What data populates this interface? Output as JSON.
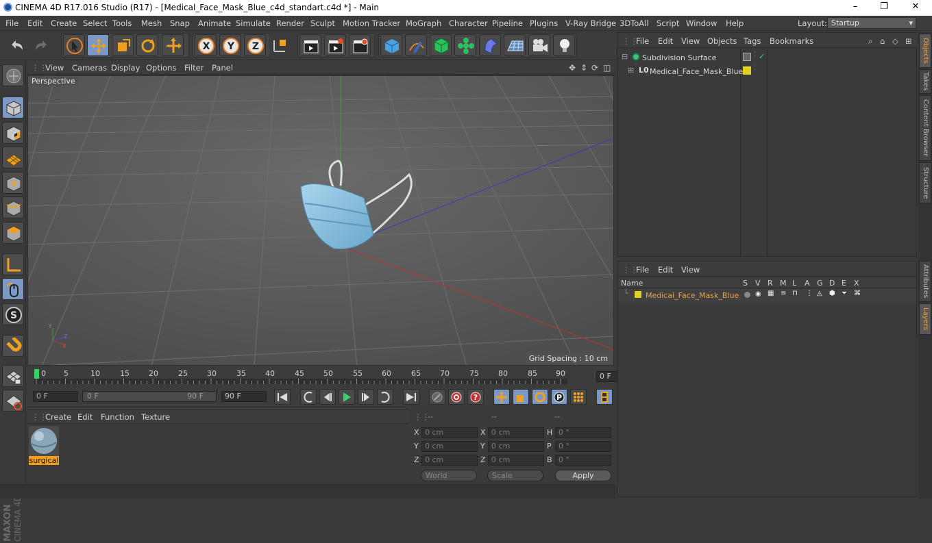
{
  "window": {
    "title": "CINEMA 4D R17.016 Studio (R17) - [Medical_Face_Mask_Blue_c4d_standart.c4d *] - Main",
    "controls": {
      "minimize": "–",
      "maximize": "❐",
      "close": "✕"
    }
  },
  "menubar": {
    "items": [
      "File",
      "Edit",
      "Create",
      "Select",
      "Tools",
      "Mesh",
      "Snap",
      "Animate",
      "Simulate",
      "Render",
      "Sculpt",
      "Motion Tracker",
      "MoGraph",
      "Character",
      "Pipeline",
      "Plugins",
      "V-Ray Bridge",
      "3DToAll",
      "Script",
      "Window",
      "Help"
    ],
    "layout_label": "Layout:",
    "layout_value": "Startup"
  },
  "viewport": {
    "menu": [
      "View",
      "Cameras",
      "Display",
      "Options",
      "Filter",
      "Panel"
    ],
    "label": "Perspective",
    "grid_spacing": "Grid Spacing : 10 cm",
    "axis_labels": {
      "x": "X",
      "y": "Y",
      "z": "Z"
    }
  },
  "timeline": {
    "ticks": [
      "0",
      "5",
      "10",
      "15",
      "20",
      "25",
      "30",
      "35",
      "40",
      "45",
      "50",
      "55",
      "60",
      "65",
      "70",
      "75",
      "80",
      "85",
      "90"
    ],
    "current_frame": "0 F"
  },
  "transport": {
    "start_field": "0 F",
    "range_start": "0 F",
    "range_end": "90 F",
    "end_field": "90 F"
  },
  "materials": {
    "menu": [
      "Create",
      "Edit",
      "Function",
      "Texture"
    ],
    "items": [
      {
        "name": "surgical"
      }
    ]
  },
  "coordinates": {
    "headers": [
      "--",
      "--",
      "--"
    ],
    "rows": [
      {
        "l1": "X",
        "v1": "0 cm",
        "l2": "X",
        "v2": "0 cm",
        "l3": "H",
        "v3": "0 °"
      },
      {
        "l1": "Y",
        "v1": "0 cm",
        "l2": "Y",
        "v2": "0 cm",
        "l3": "P",
        "v3": "0 °"
      },
      {
        "l1": "Z",
        "v1": "0 cm",
        "l2": "Z",
        "v2": "0 cm",
        "l3": "B",
        "v3": "0 °"
      }
    ],
    "mode_select": "World",
    "scale_select": "Scale",
    "apply_label": "Apply"
  },
  "objects_panel": {
    "menu": [
      "File",
      "Edit",
      "View",
      "Objects",
      "Tags",
      "Bookmarks"
    ],
    "items": [
      {
        "name": "Subdivision Surface"
      },
      {
        "name": "Medical_Face_Mask_Blue"
      }
    ]
  },
  "layers_panel": {
    "menu": [
      "File",
      "Edit",
      "View"
    ],
    "columns": [
      "Name",
      "S",
      "V",
      "R",
      "M",
      "L",
      "A",
      "G",
      "D",
      "E",
      "X"
    ],
    "items": [
      {
        "name": "Medical_Face_Mask_Blue"
      }
    ]
  },
  "side_tabs": [
    "Objects",
    "Takes",
    "Content Browser",
    "Structure",
    "Attributes",
    "Layers"
  ],
  "colors": {
    "accent_blue": "#7c98c4",
    "layer_yellow": "#e0d020",
    "layer_name_orange": "#f0a040",
    "object_green": "#40c080"
  }
}
